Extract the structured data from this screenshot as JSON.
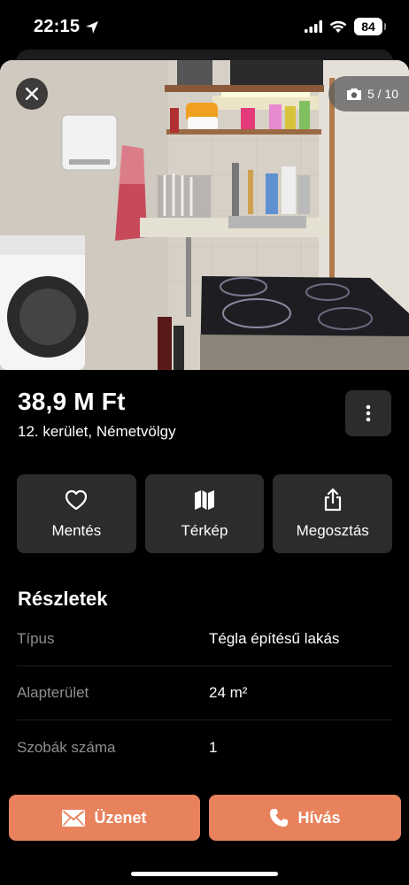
{
  "status_bar": {
    "time": "22:15",
    "battery": "84"
  },
  "gallery": {
    "counter": "5 / 10"
  },
  "listing": {
    "price": "38,9 M Ft",
    "location": "12. kerület, Németvölgy"
  },
  "actions": {
    "save": "Mentés",
    "map": "Térkép",
    "share": "Megosztás"
  },
  "details": {
    "title": "Részletek",
    "rows": [
      {
        "label": "Típus",
        "value": "Tégla építésű lakás"
      },
      {
        "label": "Alapterület",
        "value": "24 m²"
      },
      {
        "label": "Szobák száma",
        "value": "1"
      }
    ]
  },
  "bottom_bar": {
    "message_label": "Üzenet",
    "call_label": "Hívás"
  },
  "colors": {
    "accent": "#e8825c",
    "button_bg": "#2c2c2e",
    "background": "#000000"
  }
}
